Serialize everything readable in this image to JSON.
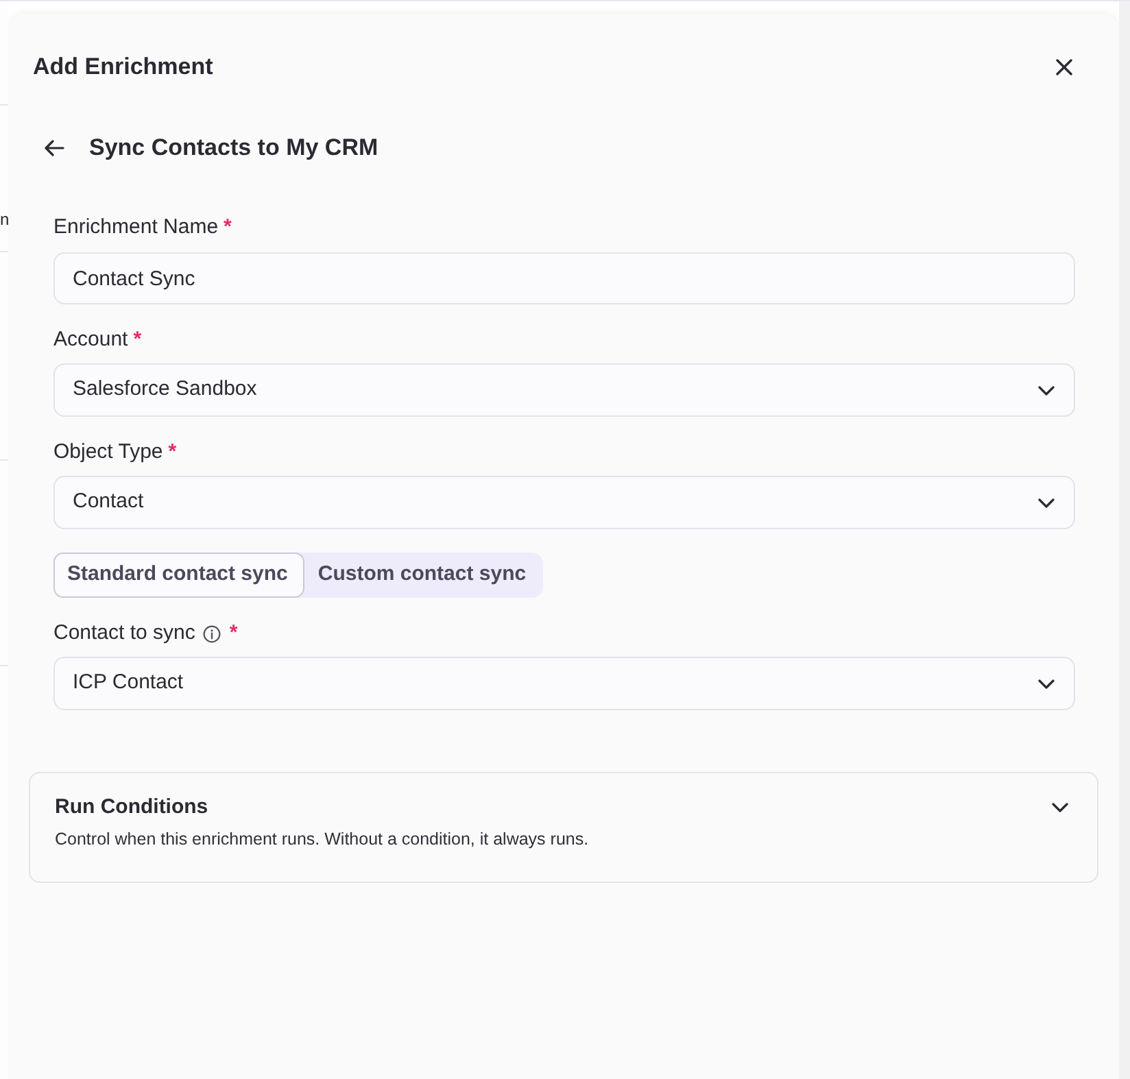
{
  "background": {
    "text": "n"
  },
  "panel": {
    "title": "Add Enrichment"
  },
  "header": {
    "title": "Sync Contacts to My CRM"
  },
  "fields": [
    {
      "kind": "text",
      "label": "Enrichment Name",
      "required_mark": "*",
      "value": "Contact Sync"
    },
    {
      "kind": "select",
      "label": "Account",
      "required_mark": "*",
      "value": "Salesforce Sandbox"
    },
    {
      "kind": "select",
      "label": "Object Type",
      "required_mark": "*",
      "value": "Contact"
    },
    {
      "kind": "segmented",
      "options": [
        {
          "label": "Standard contact sync",
          "selected": true
        },
        {
          "label": "Custom contact sync",
          "selected": false
        }
      ]
    },
    {
      "kind": "select",
      "label": "Contact to sync",
      "info_icon": true,
      "required_mark": "*",
      "value": "ICP Contact"
    }
  ],
  "run_conditions": {
    "title": "Run Conditions",
    "description": "Control when this enrichment runs. Without a condition, it always runs.",
    "expanded": false
  }
}
